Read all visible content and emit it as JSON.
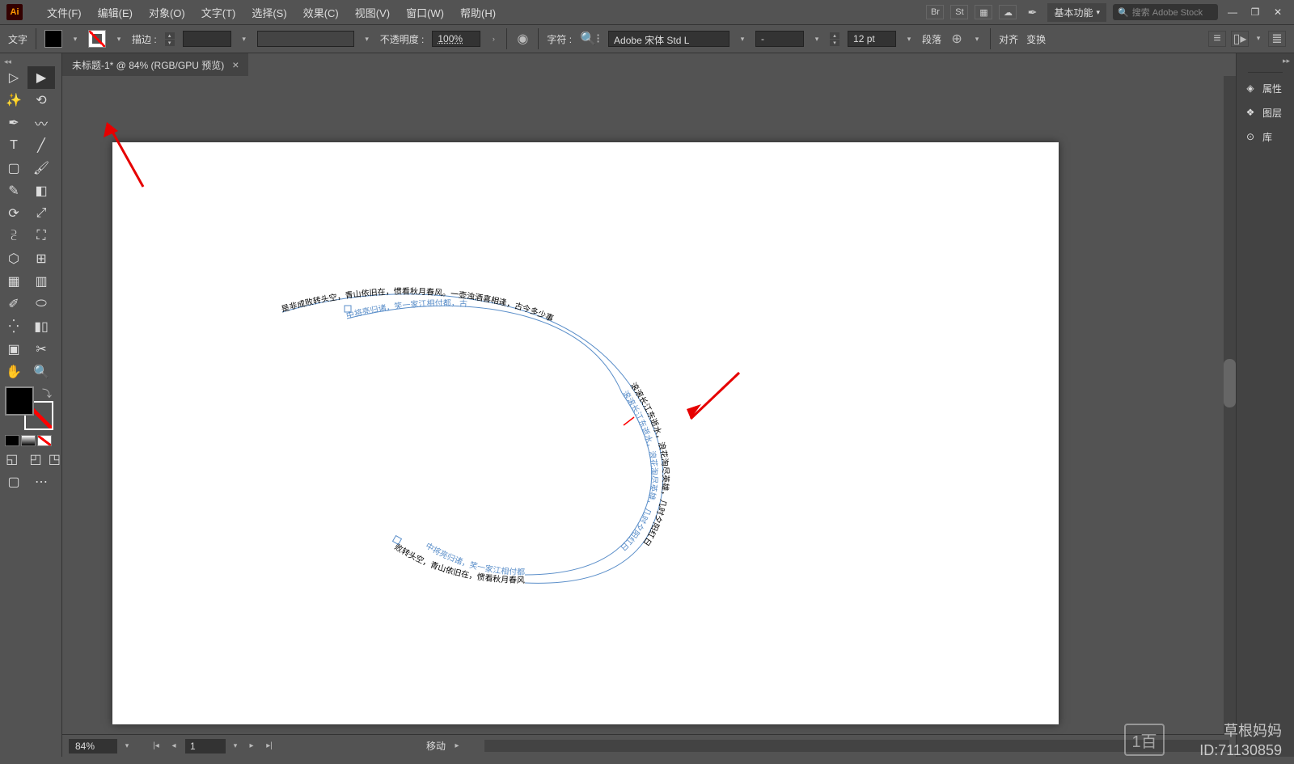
{
  "menubar": {
    "items": [
      "文件(F)",
      "编辑(E)",
      "对象(O)",
      "文字(T)",
      "选择(S)",
      "效果(C)",
      "视图(V)",
      "窗口(W)",
      "帮助(H)"
    ],
    "workspace": "基本功能",
    "search_placeholder": "搜索 Adobe Stock"
  },
  "optbar": {
    "tool_label": "文字",
    "stroke_label": "描边 :",
    "opacity_label": "不透明度 :",
    "opacity_value": "100%",
    "char_label": "字符 :",
    "font_name": "Adobe 宋体 Std L",
    "font_style": "-",
    "font_size": "12 pt",
    "para_label": "段落",
    "align_label": "对齐",
    "transform_label": "变换"
  },
  "tab": {
    "title": "未标题-1* @ 84% (RGB/GPU 预览)"
  },
  "right_panel": {
    "items": [
      "属性",
      "图层",
      "库"
    ]
  },
  "status": {
    "zoom": "84%",
    "artboard": "1",
    "mode": "移动"
  },
  "watermark": {
    "name": "草根妈妈",
    "id": "ID:71130859"
  },
  "path_text": {
    "outer1": "是非成败转头空，青山依旧在，惯看秋月春风。一壶浊酒喜相逢，古今多少事",
    "inner1": "中将亮归诸，笑一家江相付都，古",
    "outer2": "滚滚长江东逝水，浪花淘尽英雄，几时夕阳红日",
    "outer3": "是非成败转头空，青山依旧在，惯看秋月春风",
    "inner3": "中将亮归诸，笑一家江相付都"
  }
}
